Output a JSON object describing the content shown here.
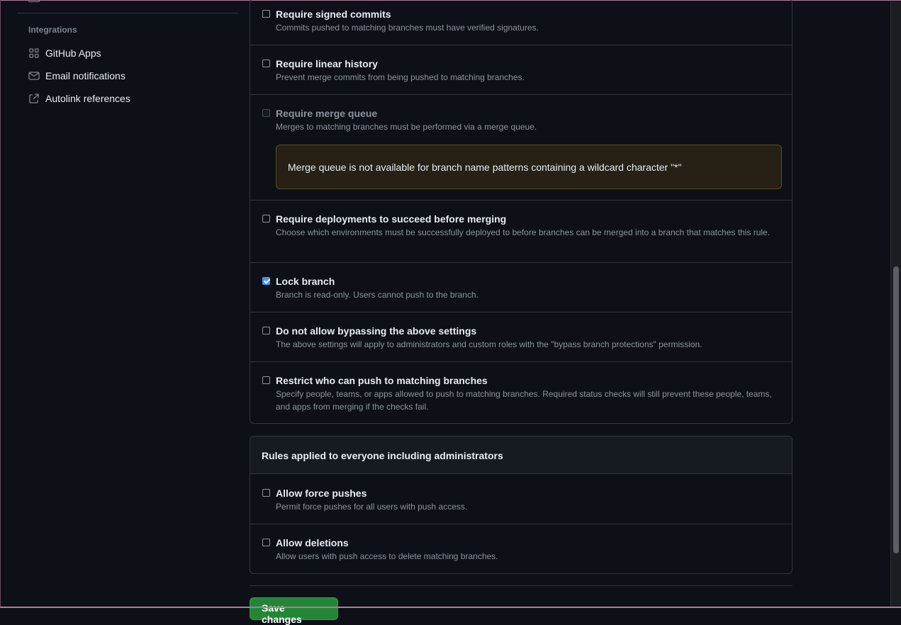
{
  "sidebar": {
    "section_heading": "Integrations",
    "items": [
      {
        "label": "GitHub Apps",
        "icon": "apps-icon"
      },
      {
        "label": "Email notifications",
        "icon": "mail-icon"
      },
      {
        "label": "Autolink references",
        "icon": "link-external-icon"
      }
    ]
  },
  "rules": [
    {
      "title": "Require signed commits",
      "description": "Commits pushed to matching branches must have verified signatures.",
      "checked": false,
      "disabled": false
    },
    {
      "title": "Require linear history",
      "description": "Prevent merge commits from being pushed to matching branches.",
      "checked": false,
      "disabled": false
    },
    {
      "title": "Require merge queue",
      "description": "Merges to matching branches must be performed via a merge queue.",
      "checked": false,
      "disabled": true,
      "warning": "Merge queue is not available for branch name patterns containing a wildcard character \"*\""
    },
    {
      "title": "Require deployments to succeed before merging",
      "description": "Choose which environments must be successfully deployed to before branches can be merged into a branch that matches this rule.",
      "checked": false,
      "disabled": false
    },
    {
      "title": "Lock branch",
      "description": "Branch is read-only. Users cannot push to the branch.",
      "checked": true,
      "disabled": false
    },
    {
      "title": "Do not allow bypassing the above settings",
      "description": "The above settings will apply to administrators and custom roles with the \"bypass branch protections\" permission.",
      "checked": false,
      "disabled": false
    },
    {
      "title": "Restrict who can push to matching branches",
      "description": "Specify people, teams, or apps allowed to push to matching branches. Required status checks will still prevent these people, teams, and apps from merging if the checks fail.",
      "checked": false,
      "disabled": false
    }
  ],
  "everyone": {
    "title": "Rules applied to everyone including administrators",
    "rules": [
      {
        "title": "Allow force pushes",
        "description": "Permit force pushes for all users with push access.",
        "checked": false
      },
      {
        "title": "Allow deletions",
        "description": "Allow users with push access to delete matching branches.",
        "checked": false
      }
    ]
  },
  "save_label": "Save changes",
  "colors": {
    "accent_green": "#238636",
    "checkbox_blue": "#4493f8",
    "warning_bg": "#272115"
  }
}
